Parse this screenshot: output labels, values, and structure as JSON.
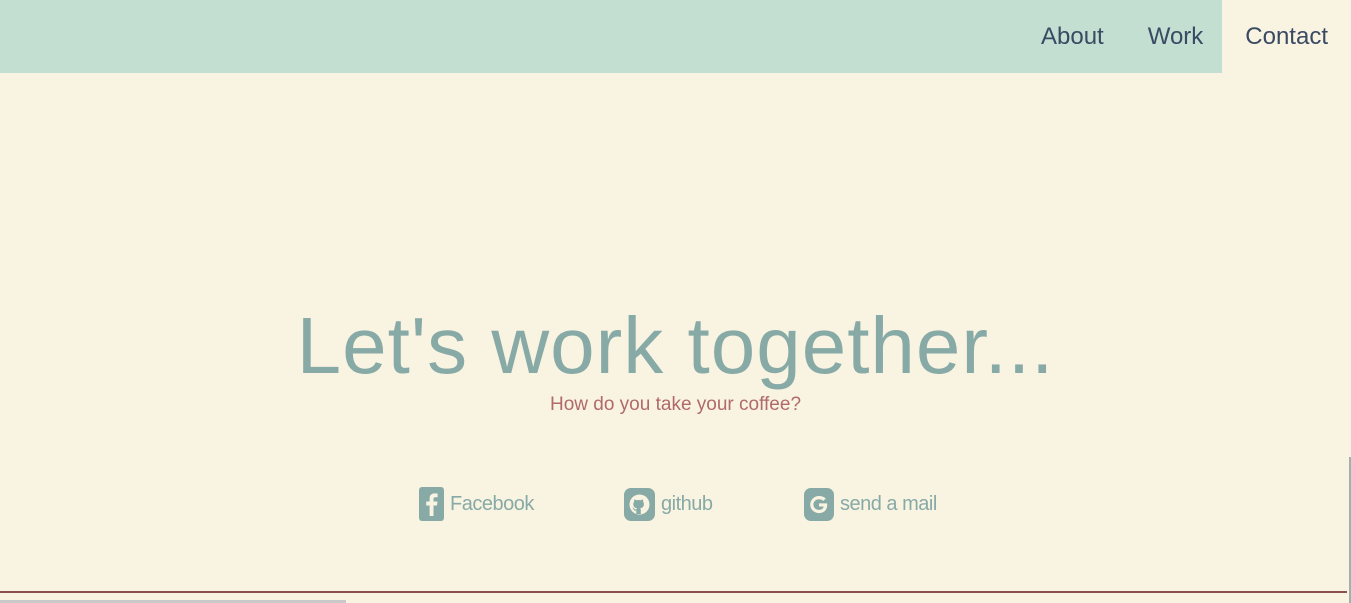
{
  "nav": {
    "items": [
      {
        "label": "About"
      },
      {
        "label": "Work"
      },
      {
        "label": "Contact"
      }
    ],
    "active": "Contact"
  },
  "hero": {
    "title": "Let's work together...",
    "subtitle": "How do you take your coffee?"
  },
  "links": [
    {
      "label": "Facebook",
      "icon": "facebook-icon"
    },
    {
      "label": "github",
      "icon": "github-icon"
    },
    {
      "label": "send a mail",
      "icon": "google-icon"
    }
  ],
  "colors": {
    "background": "#f9f3e1",
    "nav_bar": "#c2dfd1",
    "nav_text": "#3a4a63",
    "accent": "#87aaa6",
    "subtitle": "#b06a6a",
    "rule": "#8b4f4f"
  }
}
